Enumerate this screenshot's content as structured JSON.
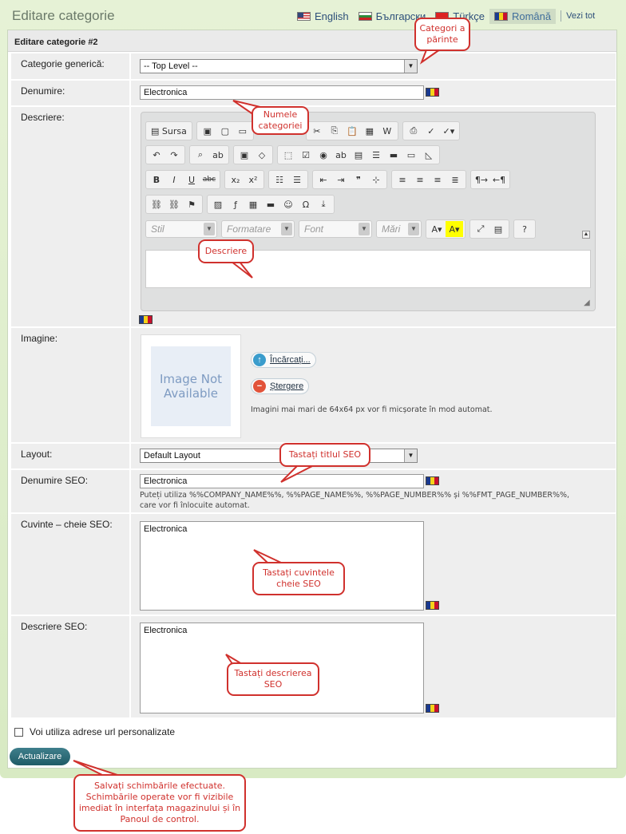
{
  "page": {
    "title": "Editare categorie",
    "view_all": "Vezi tot"
  },
  "languages": [
    {
      "label": "English",
      "flag": "us-flag-icon"
    },
    {
      "label": "Български",
      "flag": "bg-flag-icon"
    },
    {
      "label": "Türkçe",
      "flag": "tr-flag-icon"
    },
    {
      "label": "Română",
      "flag": "ro-flag-icon",
      "active": true
    }
  ],
  "panel": {
    "header": "Editare categorie #2"
  },
  "form": {
    "parent_label": "Categorie generică:",
    "parent_value": "-- Top Level --",
    "name_label": "Denumire:",
    "name_value": "Electronica",
    "description_label": "Descriere:",
    "image_label": "Imagine:",
    "image_placeholder_line1": "Image Not",
    "image_placeholder_line2": "Available",
    "upload_button": "Încărcați...",
    "delete_button": "Ștergere",
    "image_note": "Imagini mai mari de 64x64 px vor fi micșorate în mod automat.",
    "layout_label": "Layout:",
    "layout_value": "Default Layout",
    "seo_name_label": "Denumire SEO:",
    "seo_name_value": "Electronica",
    "seo_name_hint_line1": "Puteți utiliza %%COMPANY_NAME%%, %%PAGE_NAME%%, %%PAGE_NUMBER%% și %%FMT_PAGE_NUMBER%%,",
    "seo_name_hint_line2": "care vor fi înlocuite automat.",
    "seo_keywords_label": "Cuvinte – cheie SEO:",
    "seo_keywords_value": "Electronica",
    "seo_description_label": "Descriere SEO:",
    "seo_description_value": "Electronica",
    "custom_url_label": "Voi utiliza adrese url personalizate",
    "custom_url_checked": false,
    "update_button": "Actualizare"
  },
  "editor": {
    "source_label": "Sursa",
    "style_placeholder": "Stil",
    "format_placeholder": "Formatare",
    "font_placeholder": "Font",
    "size_placeholder": "Mări"
  },
  "callouts": {
    "parent": "Categori a părinte",
    "name": "Numele categoriei",
    "description": "Descriere",
    "seo_title": "Tastați titlul SEO",
    "seo_keywords": "Tastați cuvintele cheie SEO",
    "seo_description": "Tastați descrierea SEO",
    "save": "Salvați schimbările efectuate. Schimbările operate vor fi vizibile imediat în interfața magazinului și în Panoul de control."
  },
  "colors": {
    "callout": "#d0312d",
    "accent": "#1f5b66",
    "frame": "#d8eac3"
  }
}
